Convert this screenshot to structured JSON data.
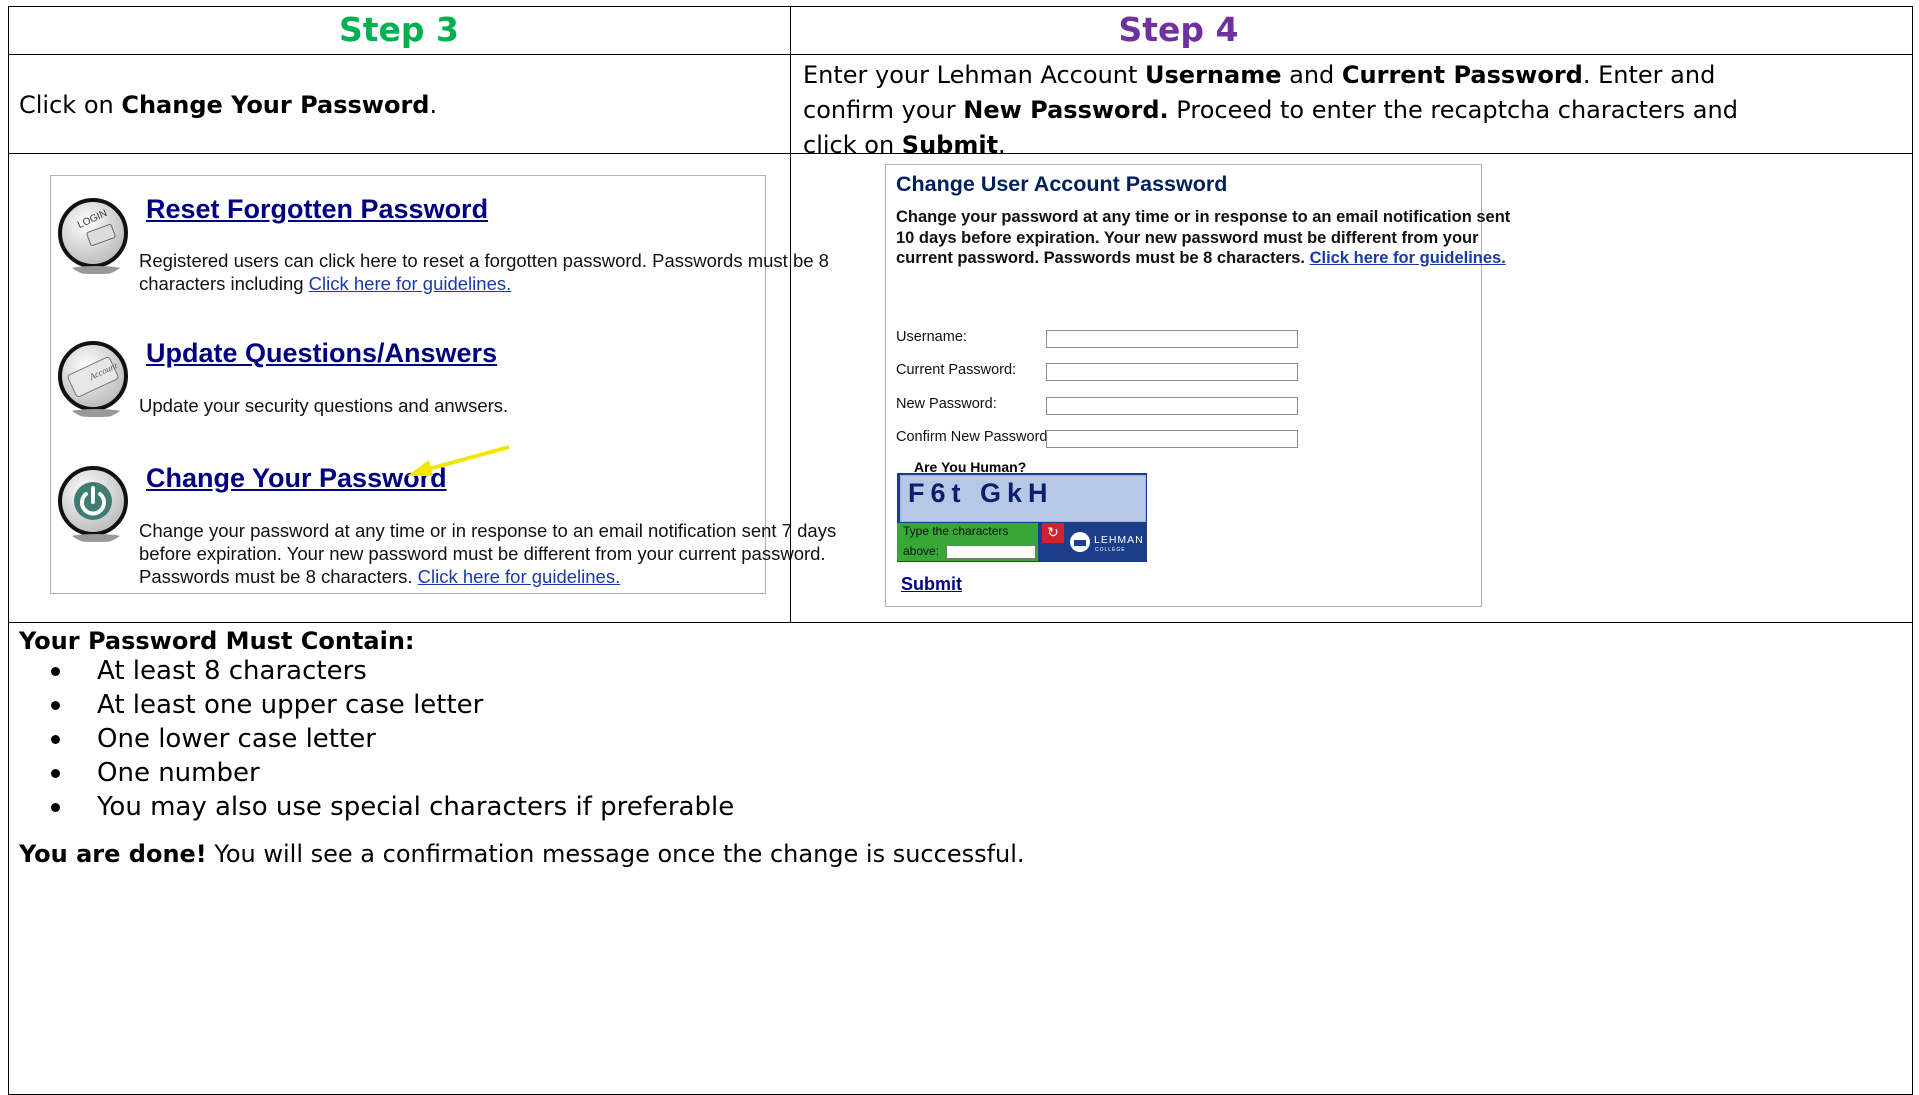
{
  "table": {
    "step3": {
      "title": "Step 3",
      "instruction_prefix": "Click on ",
      "instruction_bold": "Change Your Password",
      "instruction_suffix": "."
    },
    "step4": {
      "title": "Step 4",
      "line1_prefix": "Enter your Lehman Account ",
      "line1_bold1": "Username",
      "line1_mid": " and ",
      "line1_bold2": "Current Password",
      "line1_suffix": ". Enter and",
      "line2_prefix": "confirm your ",
      "line2_bold": "New Password.",
      "line2_suffix": " Proceed to enter the recaptcha characters and",
      "line3_prefix": "click on ",
      "line3_bold": "Submit",
      "line3_suffix": "."
    }
  },
  "self_service": {
    "options": [
      {
        "title": "Reset Forgotten Password",
        "icon": "login-keyboard-icon",
        "desc_line1": "Registered users can click here to reset a forgotten password. Passwords must be 8",
        "desc_line2": "characters including ",
        "link": "Click here for guidelines."
      },
      {
        "title": "Update Questions/Answers",
        "icon": "account-card-icon",
        "desc_line1": "Update your security questions and anwsers."
      },
      {
        "title": "Change Your Password",
        "icon": "power-icon",
        "desc_line1": "Change your password at any time or in response to an email notification sent 7 days",
        "desc_line2": "before expiration. Your new password must be different from your current password.",
        "desc_line3": "Passwords must be 8 characters. ",
        "link": "Click here for guidelines."
      }
    ],
    "arrow_color": "#f2e600"
  },
  "change_form": {
    "title": "Change User Account Password",
    "desc_line1": "Change your password at any time or in response to an email notification sent",
    "desc_line2": "10 days before expiration. Your new password must be different from your",
    "desc_line3": "current password. Passwords must be 8 characters. ",
    "desc_link": "Click here for guidelines.",
    "fields": {
      "username": "Username:",
      "current_password": "Current Password:",
      "new_password": "New Password:",
      "confirm_password": "Confirm New Password:"
    },
    "captcha": {
      "question": "Are You Human?",
      "characters": "F6t GkH",
      "entry_label_line1": "Type the characters",
      "entry_label_line2": "above:",
      "logo_text": "LEHMAN",
      "logo_sub": "COLLEGE"
    },
    "submit_label": "Submit"
  },
  "requirements": {
    "title": "Your Password Must Contain:",
    "items": [
      "At least 8 characters",
      "At least one upper case letter",
      "One lower case letter",
      "One number",
      "You may also use special characters if preferable"
    ]
  },
  "done": {
    "bold": "You are done!",
    "text": " You will see a confirmation message once the change is successful."
  },
  "colors": {
    "step3": "#00b050",
    "step4": "#7030a0",
    "link_title": "#000080",
    "captcha_green": "#38a738"
  }
}
